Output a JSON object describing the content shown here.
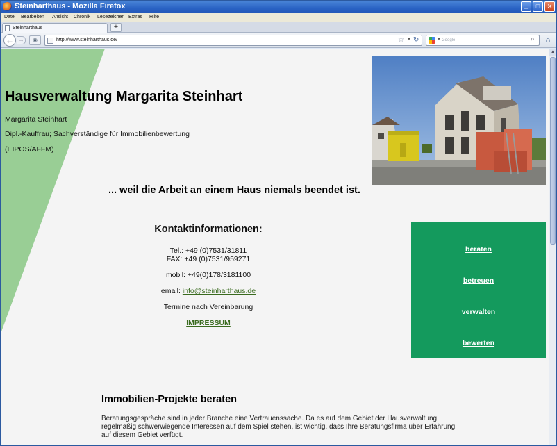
{
  "window": {
    "title": "Steinharthaus - Mozilla Firefox",
    "controls": {
      "minimize": "_",
      "maximize": "□",
      "close": "✕"
    }
  },
  "menubar": [
    "Datei",
    "Bearbeiten",
    "Ansicht",
    "Chronik",
    "Lesezeichen",
    "Extras",
    "Hilfe"
  ],
  "tabs": {
    "active_label": "Steinharthaus",
    "new_tab": "+"
  },
  "navbar": {
    "url": "http://www.steinharthaus.de/",
    "search_placeholder": "Google"
  },
  "page": {
    "title": "Hausverwaltung Margarita Steinhart",
    "owner_lines": [
      "Margarita Steinhart",
      "Dipl.-Kauffrau; Sachverständige für Immobilienbewertung",
      "(EIPOS/AFFM)"
    ],
    "tagline": "... weil die Arbeit an einem Haus niemals beendet ist.",
    "contact": {
      "heading": "Kontaktinformationen:",
      "tel": "Tel.: +49 (0)7531/31811",
      "fax": "FAX: +49 (0)7531/959271",
      "mobil": "mobil: +49(0)178/3181100",
      "email_prefix": "email: ",
      "email": "info@steinharthaus.de",
      "appointments": "Termine nach Vereinbarung",
      "impressum": "IMPRESSUM"
    },
    "service_nav": [
      "beraten",
      "betreuen",
      "verwalten",
      "bewerten"
    ],
    "section": {
      "title": "Immobilien-Projekte beraten",
      "text": "Beratungsgespräche sind in jeder Branche eine Vertrauenssache. Da es auf dem Gebiet der Hausverwaltung regelmäßig schwerwiegende Interessen auf dem Spiel stehen, ist wichtig, dass Ihre Beratungsfirma über Erfahrung auf diesem Gebiet verfügt."
    }
  },
  "colors": {
    "accent_green": "#149a5d",
    "wedge_green": "#99ce95",
    "link_green": "#3a6b1f"
  }
}
